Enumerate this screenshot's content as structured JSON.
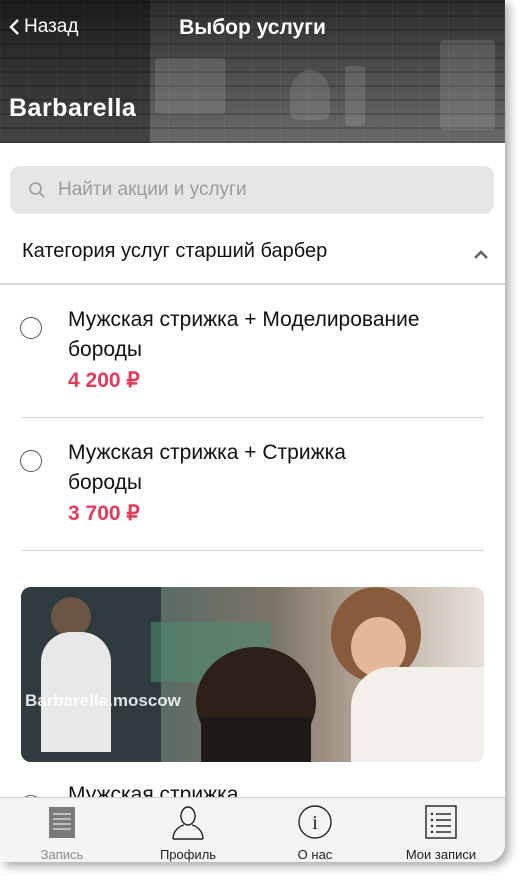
{
  "header": {
    "back_label": "Назад",
    "title": "Выбор услуги",
    "brand": "Barbarella"
  },
  "search": {
    "placeholder": "Найти акции и услуги"
  },
  "category": {
    "label": "Категория услуг старший барбер",
    "expanded": true
  },
  "services": [
    {
      "name": "Мужская стрижка + Моделирование бороды",
      "price": "4 200 ₽",
      "selected": false
    },
    {
      "name": "Мужская стрижка + Стрижка бороды",
      "price": "3 700 ₽",
      "selected": false
    }
  ],
  "next_service_partial": "Мужская стрижка",
  "photo": {
    "watermark": "Barbarella.moscow"
  },
  "tabbar": {
    "items": [
      {
        "label": "Запись",
        "icon": "document-icon",
        "active": true
      },
      {
        "label": "Профиль",
        "icon": "user-icon",
        "active": false
      },
      {
        "label": "О нас",
        "icon": "info-icon",
        "active": false
      },
      {
        "label": "Мои записи",
        "icon": "list-icon",
        "active": false
      }
    ]
  },
  "colors": {
    "price": "#e53a5a",
    "search_bg": "#e6e6e6",
    "tabbar_bg": "#f4f4f4"
  }
}
